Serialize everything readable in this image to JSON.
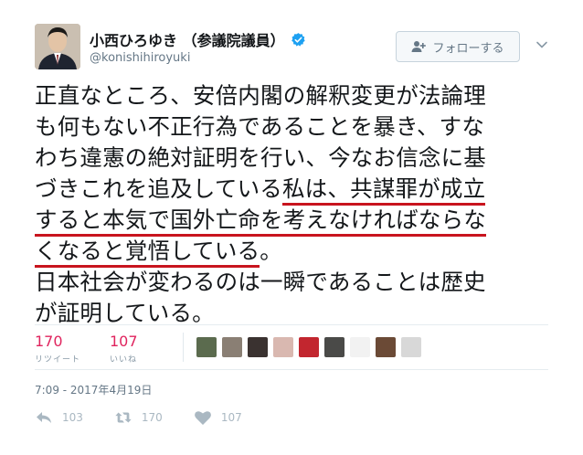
{
  "author": {
    "display_name": "小西ひろゆき （参議院議員）",
    "handle": "@konishihiroyuki",
    "verified": true
  },
  "follow_button": {
    "label": "フォローする",
    "icon": "add-user-icon"
  },
  "tweet": {
    "lines": [
      {
        "text": "正直なところ、安倍内閣の解釈変更が法論理"
      },
      {
        "text": "も何もない不正行為であることを暴き、すな"
      },
      {
        "text": "わち違憲の絶対証明を行い、今なお信念に基"
      },
      {
        "text": "づきこれを追及している",
        "underlined": "私は、共謀罪が成立"
      },
      {
        "underlined": "すると本気で国外亡命を考えなければならな"
      },
      {
        "underlined": "くなると覚悟している",
        "text_after": "。"
      },
      {
        "text": "日本社会が変わるのは一瞬であることは歴史"
      },
      {
        "text": "が証明している。"
      }
    ],
    "highlight_color": "#c8141e"
  },
  "stats": {
    "retweets": {
      "value": "170",
      "label": "リツイート"
    },
    "likes": {
      "value": "107",
      "label": "いいね"
    },
    "accent_color": "#e0245e"
  },
  "likers": [
    {
      "name": "liker-1",
      "color": "#5b6b4e"
    },
    {
      "name": "liker-2",
      "color": "#8a7f74"
    },
    {
      "name": "liker-3",
      "color": "#3a3230"
    },
    {
      "name": "liker-4",
      "color": "#d9b8b0"
    },
    {
      "name": "liker-5",
      "color": "#c2262f"
    },
    {
      "name": "liker-6",
      "color": "#4a4a48"
    },
    {
      "name": "liker-7",
      "color": "#f2f2f2"
    },
    {
      "name": "liker-8",
      "color": "#6b4a36"
    },
    {
      "name": "liker-9",
      "color": "#d8d8d8"
    }
  ],
  "timestamp": "7:09 - 2017年4月19日",
  "actions": {
    "reply": {
      "count": "103",
      "icon": "reply-icon"
    },
    "retweet": {
      "count": "170",
      "icon": "retweet-icon"
    },
    "like": {
      "count": "107",
      "icon": "heart-icon"
    }
  }
}
